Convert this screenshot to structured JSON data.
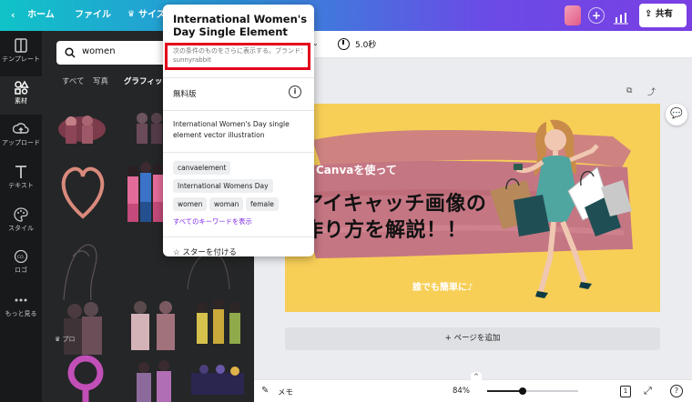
{
  "topbar": {
    "home": "ホーム",
    "file": "ファイル",
    "resize": "サイズ",
    "share": "共有"
  },
  "sidebar": {
    "items": [
      {
        "label": "テンプレート",
        "icon": "template-icon"
      },
      {
        "label": "素材",
        "icon": "elements-icon"
      },
      {
        "label": "アップロード",
        "icon": "upload-icon"
      },
      {
        "label": "テキスト",
        "icon": "text-icon"
      },
      {
        "label": "スタイル",
        "icon": "palette-icon"
      },
      {
        "label": "ロゴ",
        "icon": "logo-icon"
      },
      {
        "label": "もっと見る",
        "icon": "more-icon"
      }
    ]
  },
  "panel": {
    "search_value": "women",
    "tabs": [
      "すべて",
      "写真",
      "グラフィック"
    ],
    "pro_badge": "プロ"
  },
  "toolbar": {
    "duration": "5.0秒"
  },
  "canvas": {
    "line1": "Canvaを使って",
    "line2": "アイキャッチ画像の",
    "line3": "作り方を解説！！",
    "line4": "誰でも簡単に♪",
    "add_page": "+ ページを追加"
  },
  "bottombar": {
    "notes": "メモ",
    "zoom": "84%",
    "zoom_fraction": 0.84,
    "page_count": "1",
    "help": "?"
  },
  "popup": {
    "title": "International Women's Day Single Element",
    "subtitle": "次の条件のものをさらに表示する。ブランド：sunnyrabbit",
    "license": "無料版",
    "description": "International Women's Day single element vector illustration",
    "keywords": [
      "canvaelement",
      "International Womens Day",
      "women",
      "woman",
      "female"
    ],
    "show_all_keywords": "すべてのキーワードを表示",
    "star": "スターを付ける"
  },
  "colors": {
    "accent_purple": "#7d2ae8",
    "highlight_red": "#e3001b",
    "canvas_bg": "#f7cf57",
    "brush": "#c97a85"
  }
}
